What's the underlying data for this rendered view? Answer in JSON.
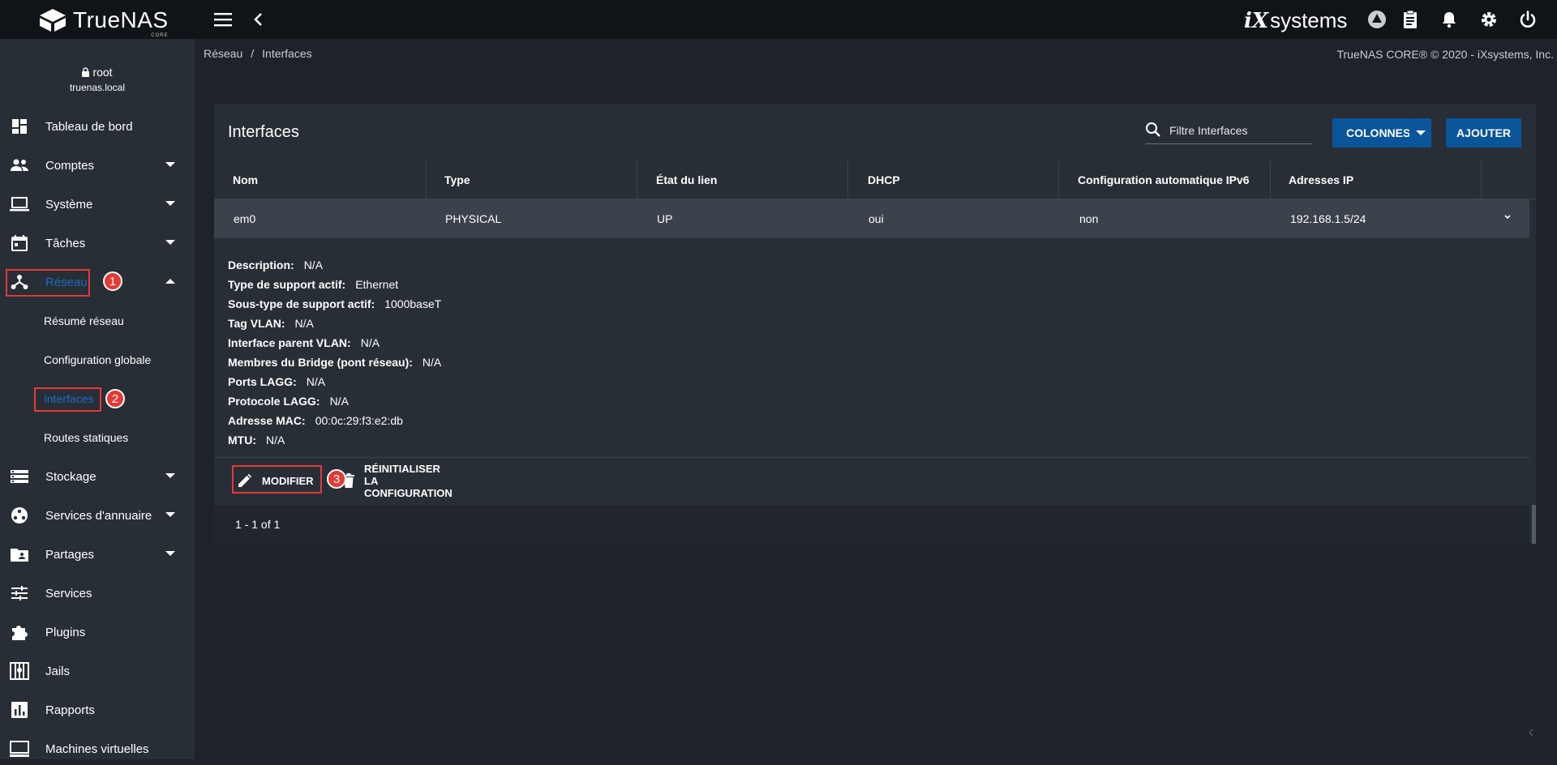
{
  "app": {
    "brand": "TrueNAS",
    "edition": "CORE",
    "vendor_ix": "iX",
    "vendor_systems": "systems"
  },
  "user": {
    "name": "root",
    "host": "truenas.local"
  },
  "sidebar": {
    "items": [
      {
        "label": "Tableau de bord",
        "icon": "dashboard-icon"
      },
      {
        "label": "Comptes",
        "icon": "people-icon",
        "expandable": true
      },
      {
        "label": "Système",
        "icon": "laptop-icon",
        "expandable": true
      },
      {
        "label": "Tâches",
        "icon": "calendar-icon",
        "expandable": true
      },
      {
        "label": "Réseau",
        "icon": "network-icon",
        "expandable": true,
        "expanded": true,
        "active": true
      },
      {
        "label": "Stockage",
        "icon": "storage-icon",
        "expandable": true
      },
      {
        "label": "Services d'annuaire",
        "icon": "directory-icon",
        "expandable": true
      },
      {
        "label": "Partages",
        "icon": "shared-folder-icon",
        "expandable": true
      },
      {
        "label": "Services",
        "icon": "tune-icon"
      },
      {
        "label": "Plugins",
        "icon": "puzzle-icon"
      },
      {
        "label": "Jails",
        "icon": "jail-icon"
      },
      {
        "label": "Rapports",
        "icon": "bar-chart-icon"
      },
      {
        "label": "Machines virtuelles",
        "icon": "computer-icon"
      }
    ],
    "network_sub": [
      {
        "label": "Résumé réseau"
      },
      {
        "label": "Configuration globale"
      },
      {
        "label": "Interfaces",
        "active": true
      },
      {
        "label": "Routes statiques"
      }
    ]
  },
  "annotations": {
    "step1": "1",
    "step2": "2",
    "step3": "3"
  },
  "breadcrumb": {
    "parent": "Réseau",
    "separator": "/",
    "current": "Interfaces"
  },
  "copyright": "TrueNAS CORE® © 2020 - iXsystems, Inc.",
  "card": {
    "title": "Interfaces",
    "filter_placeholder": "Filtre Interfaces",
    "columns_button": "COLONNES",
    "add_button": "AJOUTER"
  },
  "table": {
    "headers": [
      "Nom",
      "Type",
      "État du lien",
      "DHCP",
      "Configuration automatique IPv6",
      "Adresses IP"
    ],
    "rows": [
      [
        "em0",
        "PHYSICAL",
        "UP",
        "oui",
        "non",
        "192.168.1.5/24"
      ]
    ]
  },
  "details": [
    {
      "label": "Description:",
      "value": "N/A"
    },
    {
      "label": "Type de support actif:",
      "value": "Ethernet"
    },
    {
      "label": "Sous-type de support actif:",
      "value": "1000baseT"
    },
    {
      "label": "Tag VLAN:",
      "value": "N/A"
    },
    {
      "label": "Interface parent VLAN:",
      "value": "N/A"
    },
    {
      "label": "Membres du Bridge (pont réseau):",
      "value": "N/A"
    },
    {
      "label": "Ports LAGG:",
      "value": "N/A"
    },
    {
      "label": "Protocole LAGG:",
      "value": "N/A"
    },
    {
      "label": "Adresse MAC:",
      "value": "00:0c:29:f3:e2:db"
    },
    {
      "label": "MTU:",
      "value": "N/A"
    }
  ],
  "actions": {
    "edit": "MODIFIER",
    "reset": "RÉINITIALISER LA CONFIGURATION"
  },
  "pagination": "1 - 1 of 1",
  "colors": {
    "accent": "#0a5599",
    "active_nav": "#1e6cc4",
    "annotation": "#e53935"
  }
}
